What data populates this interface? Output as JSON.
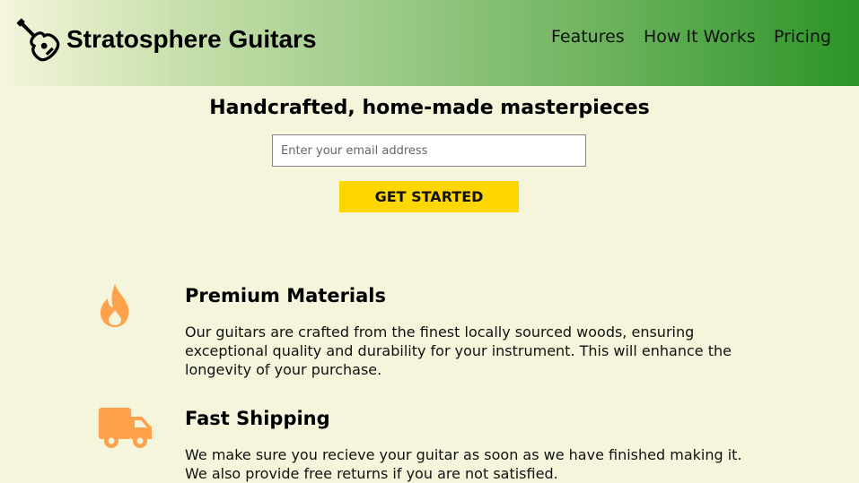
{
  "header": {
    "brand": "Stratosphere Guitars",
    "logo_icon": "guitar-icon",
    "nav": [
      "Features",
      "How It Works",
      "Pricing"
    ]
  },
  "hero": {
    "title": "Handcrafted, home-made masterpieces",
    "email_placeholder": "Enter your email address",
    "cta_label": "GET STARTED"
  },
  "features": [
    {
      "icon": "fire-icon",
      "title": "Premium Materials",
      "text": "Our guitars are crafted from the finest locally sourced woods, ensuring exceptional quality and durability for your instrument. This will enhance the longevity of your purchase."
    },
    {
      "icon": "truck-icon",
      "title": "Fast Shipping",
      "text": "We make sure you recieve your guitar as soon as we have finished making it. We also provide free returns if you are not satisfied."
    }
  ],
  "colors": {
    "background": "#f5f5dc",
    "header_gradient_end": "#2b9428",
    "cta": "#ffd700",
    "icon": "#ffa04a"
  }
}
